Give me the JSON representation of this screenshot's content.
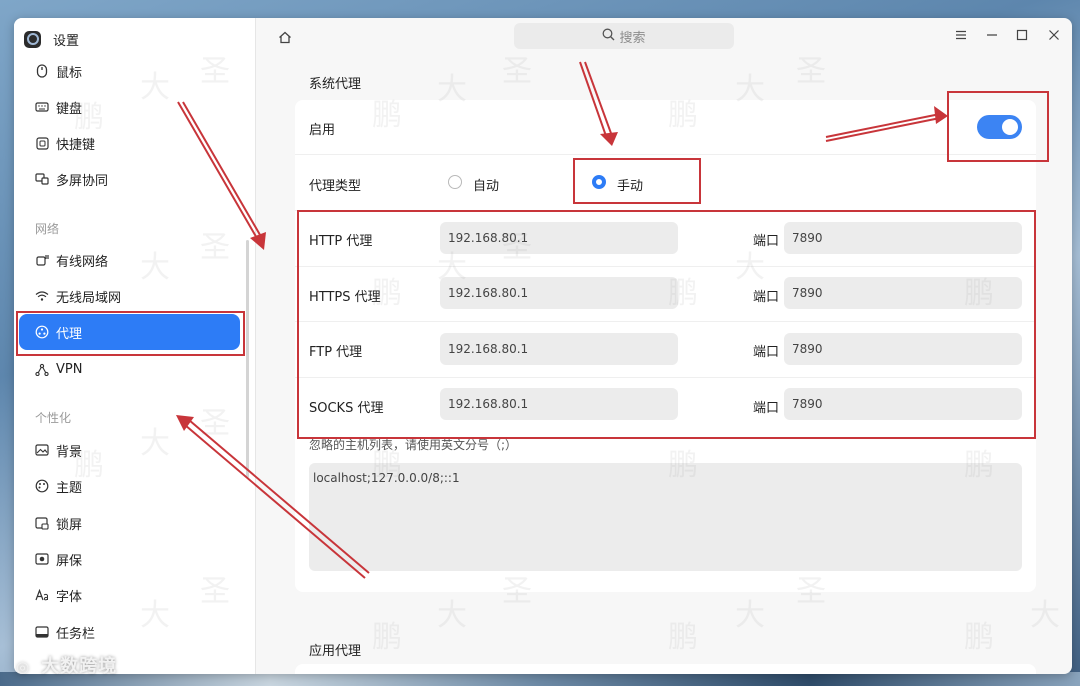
{
  "app": {
    "title": "设置"
  },
  "header": {
    "search_placeholder": "搜索"
  },
  "sidebar": {
    "items_top": [
      {
        "label": "鼠标",
        "icon": "mouse-icon"
      },
      {
        "label": "键盘",
        "icon": "keyboard-icon"
      },
      {
        "label": "快捷键",
        "icon": "shortcut-icon"
      },
      {
        "label": "多屏协同",
        "icon": "multiscreen-icon"
      }
    ],
    "section_network": "网络",
    "items_network": [
      {
        "label": "有线网络",
        "icon": "wired-network-icon"
      },
      {
        "label": "无线局域网",
        "icon": "wifi-icon"
      },
      {
        "label": "代理",
        "icon": "proxy-icon",
        "active": true
      },
      {
        "label": "VPN",
        "icon": "vpn-icon"
      }
    ],
    "section_personal": "个性化",
    "items_personal": [
      {
        "label": "背景",
        "icon": "background-icon"
      },
      {
        "label": "主题",
        "icon": "theme-icon"
      },
      {
        "label": "锁屏",
        "icon": "lockscreen-icon"
      },
      {
        "label": "屏保",
        "icon": "screensaver-icon"
      },
      {
        "label": "字体",
        "icon": "font-icon"
      },
      {
        "label": "任务栏",
        "icon": "taskbar-icon"
      }
    ]
  },
  "proxy": {
    "section_title": "系统代理",
    "enable_label": "启用",
    "enabled": true,
    "type_label": "代理类型",
    "type_options": [
      "自动",
      "手动"
    ],
    "type_selected": "手动",
    "rows": [
      {
        "label": "HTTP 代理",
        "host": "192.168.80.1",
        "port_label": "端口",
        "port": "7890"
      },
      {
        "label": "HTTPS 代理",
        "host": "192.168.80.1",
        "port_label": "端口",
        "port": "7890"
      },
      {
        "label": "FTP 代理",
        "host": "192.168.80.1",
        "port_label": "端口",
        "port": "7890"
      },
      {
        "label": "SOCKS 代理",
        "host": "192.168.80.1",
        "port_label": "端口",
        "port": "7890"
      }
    ],
    "ignore_hint": "忽略的主机列表，请使用英文分号（;）",
    "ignore_value": "localhost;127.0.0.0/8;::1",
    "app_proxy_title": "应用代理"
  },
  "watermark": {
    "chars": [
      "大",
      "圣",
      "鹏"
    ],
    "footer": "大数跨境"
  },
  "colors": {
    "accent": "#2d7cf6",
    "annotation": "#c8353a"
  }
}
